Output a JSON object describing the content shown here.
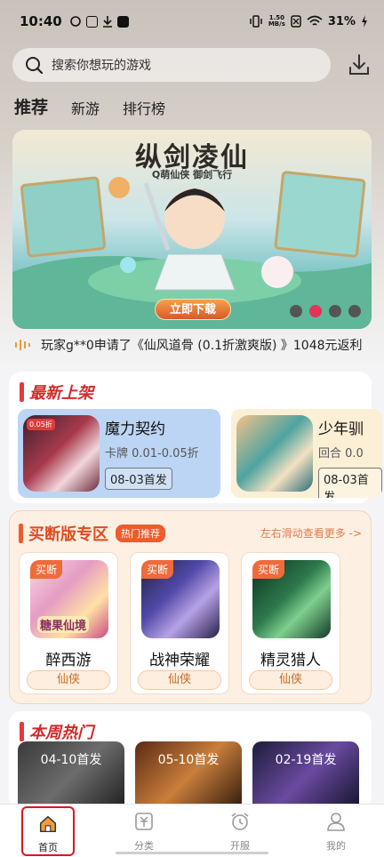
{
  "status_bar": {
    "time": "10:40",
    "net_speed": "1.50",
    "net_unit": "MB/s",
    "battery": "31%"
  },
  "search": {
    "placeholder": "搜索你想玩的游戏"
  },
  "tabs": [
    {
      "label": "推荐",
      "active": true
    },
    {
      "label": "新游",
      "active": false
    },
    {
      "label": "排行榜",
      "active": false
    }
  ],
  "banner": {
    "title": "纵剑凌仙",
    "subtitle": "Q萌仙侠 御剑飞行",
    "button": "立即下载",
    "dot_count": 4,
    "active_dot": 1
  },
  "ticker": {
    "text": "玩家g**0申请了《仙风道骨 (0.1折激爽版) 》1048元返利"
  },
  "new_section": {
    "title": "最新上架",
    "items": [
      {
        "name": "魔力契约",
        "tags": "卡牌  0.01-0.05折",
        "date": "08-03首发",
        "badge": "0.05折"
      },
      {
        "name": "少年驯",
        "tags": "回合  0.0",
        "date": "08-03首发",
        "badge": ""
      }
    ]
  },
  "buyout_section": {
    "title": "买断版专区",
    "hot_badge": "热门推荐",
    "swipe_hint": "左右滑动查看更多 ->",
    "items": [
      {
        "badge": "买断",
        "name": "醉西游",
        "tag": "仙侠",
        "logo_text": "糖果仙境"
      },
      {
        "badge": "买断",
        "name": "战神荣耀",
        "tag": "仙侠"
      },
      {
        "badge": "买断",
        "name": "精灵猎人",
        "tag": "仙侠"
      }
    ]
  },
  "weekly_section": {
    "title": "本周热门",
    "items": [
      {
        "date": "04-10首发"
      },
      {
        "date": "05-10首发"
      },
      {
        "date": "02-19首发"
      }
    ]
  },
  "bottom_nav": [
    {
      "label": "首页",
      "icon": "home-icon",
      "active": true
    },
    {
      "label": "分类",
      "icon": "category-icon",
      "active": false
    },
    {
      "label": "开服",
      "icon": "alarm-clock-icon",
      "active": false
    },
    {
      "label": "我的",
      "icon": "user-icon",
      "active": false
    }
  ],
  "colors": {
    "accent_red": "#e23b3b",
    "buyout_orange": "#ef5b2c",
    "tag_orange": "#c8691d"
  }
}
